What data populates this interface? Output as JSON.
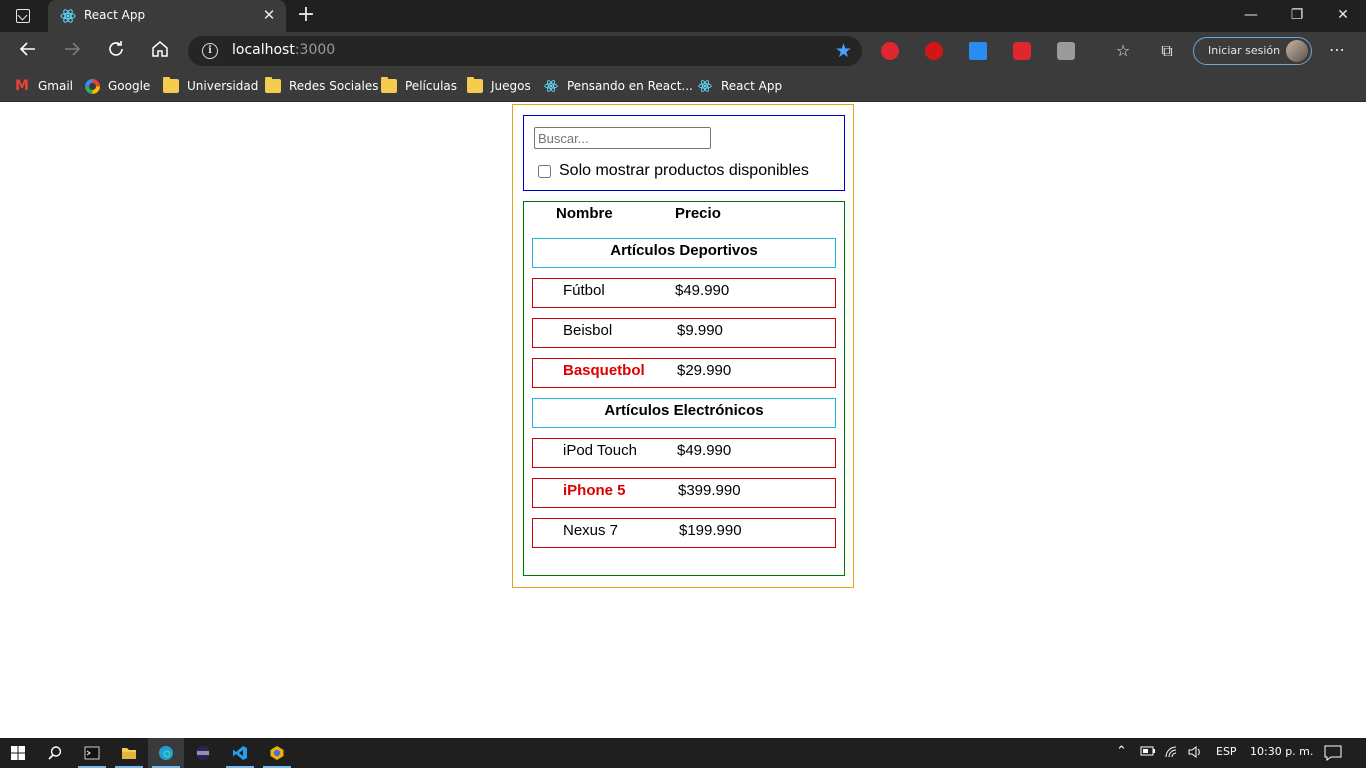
{
  "browser": {
    "tab_title": "React App",
    "tab_close": "✕",
    "new_tab": "+",
    "window_controls": {
      "minimize": "—",
      "restore": "❐",
      "close": "✕"
    },
    "url_host": "localhost",
    "url_port": ":3000",
    "signin_label": "Iniciar sesión",
    "bookmarks": [
      {
        "label": "Gmail",
        "icon": "gmail-icon"
      },
      {
        "label": "Google",
        "icon": "google-icon"
      },
      {
        "label": "Universidad",
        "icon": "folder-icon"
      },
      {
        "label": "Redes Sociales",
        "icon": "folder-icon"
      },
      {
        "label": "Películas",
        "icon": "folder-icon"
      },
      {
        "label": "Juegos",
        "icon": "folder-icon"
      },
      {
        "label": "Pensando en React...",
        "icon": "react-icon"
      },
      {
        "label": "React App",
        "icon": "react-icon"
      }
    ]
  },
  "app": {
    "search_placeholder": "Buscar...",
    "search_value": "",
    "in_stock_label": "Solo mostrar productos disponibles",
    "in_stock_checked": false,
    "headers": {
      "name": "Nombre",
      "price": "Precio"
    },
    "categories": [
      {
        "name": "Artículos Deportivos",
        "products": [
          {
            "name": "Fútbol",
            "price": "$49.990",
            "stocked": true
          },
          {
            "name": "Beisbol",
            "price": "$9.990",
            "stocked": true
          },
          {
            "name": "Basquetbol",
            "price": "$29.990",
            "stocked": false
          }
        ]
      },
      {
        "name": "Artículos Electrónicos",
        "products": [
          {
            "name": "iPod Touch",
            "price": "$49.990",
            "stocked": true
          },
          {
            "name": "iPhone 5",
            "price": "$399.990",
            "stocked": false
          },
          {
            "name": "Nexus 7",
            "price": "$199.990",
            "stocked": true
          }
        ]
      }
    ]
  },
  "taskbar": {
    "language": "ESP",
    "time": "10:30 p. m."
  },
  "colors": {
    "out_of_stock": "#dd0000",
    "app_border": "#e8a317",
    "search_border": "#0000cc",
    "table_border": "#007700",
    "category_border": "#22b5d6",
    "product_border": "#cc0000"
  }
}
